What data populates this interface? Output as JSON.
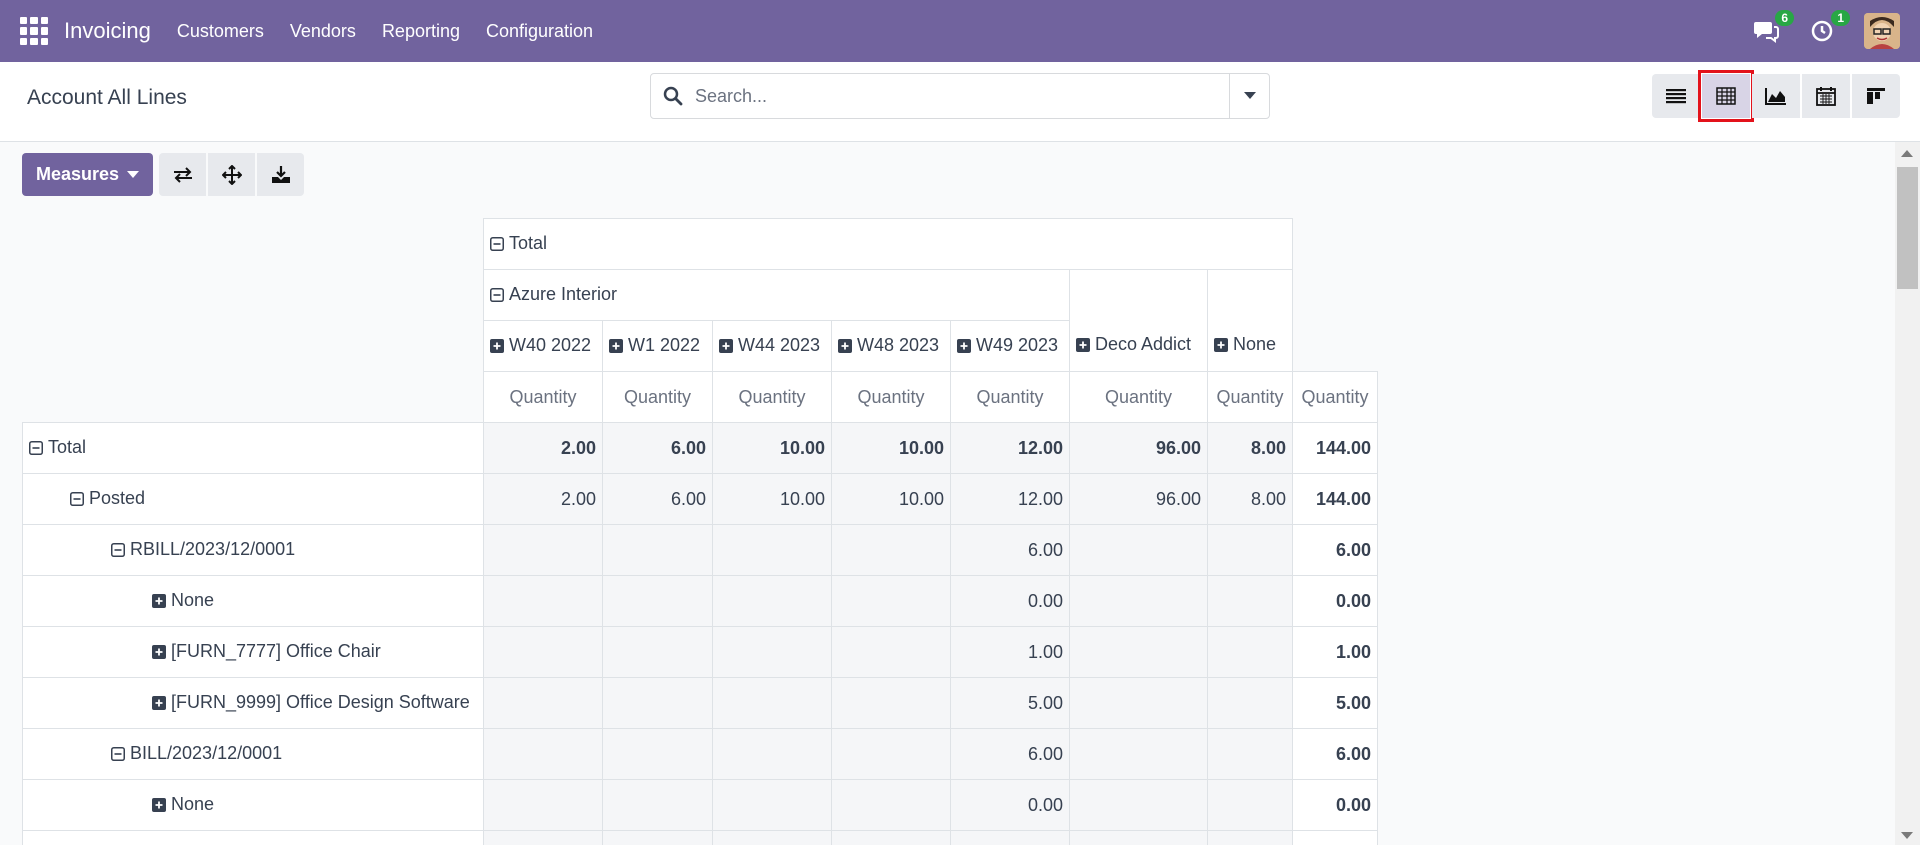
{
  "app": {
    "brand": "Invoicing",
    "menu": [
      "Customers",
      "Vendors",
      "Reporting",
      "Configuration"
    ],
    "messages_count": "6",
    "activities_count": "1"
  },
  "control_panel": {
    "title": "Account All Lines",
    "search_placeholder": "Search...",
    "views": [
      "list-view",
      "pivot-view",
      "graph-view",
      "calendar-view",
      "kanban-view"
    ],
    "active_view": "pivot-view"
  },
  "toolbar": {
    "measures_label": "Measures"
  },
  "pivot": {
    "col_headers": {
      "total": "Total",
      "azure": "Azure Interior",
      "weeks": [
        "W40 2022",
        "W1 2022",
        "W44 2023",
        "W48 2023",
        "W49 2023"
      ],
      "deco": "Deco Addict",
      "none": "None",
      "measure": "Quantity"
    },
    "rows": [
      {
        "label": "Total",
        "level": 0,
        "icon": "minus",
        "bold": true,
        "values": [
          "2.00",
          "6.00",
          "10.00",
          "10.00",
          "12.00",
          "96.00",
          "8.00"
        ],
        "total": "144.00"
      },
      {
        "label": "Posted",
        "level": 1,
        "icon": "minus",
        "values": [
          "2.00",
          "6.00",
          "10.00",
          "10.00",
          "12.00",
          "96.00",
          "8.00"
        ],
        "total": "144.00"
      },
      {
        "label": "RBILL/2023/12/0001",
        "level": 2,
        "icon": "minus",
        "values": [
          "",
          "",
          "",
          "",
          "6.00",
          "",
          ""
        ],
        "total": "6.00"
      },
      {
        "label": "None",
        "level": 3,
        "icon": "plus",
        "values": [
          "",
          "",
          "",
          "",
          "0.00",
          "",
          ""
        ],
        "total": "0.00"
      },
      {
        "label": "[FURN_7777] Office Chair",
        "level": 3,
        "icon": "plus",
        "values": [
          "",
          "",
          "",
          "",
          "1.00",
          "",
          ""
        ],
        "total": "1.00"
      },
      {
        "label": "[FURN_9999] Office Design Software",
        "level": 3,
        "icon": "plus",
        "values": [
          "",
          "",
          "",
          "",
          "5.00",
          "",
          ""
        ],
        "total": "5.00"
      },
      {
        "label": "BILL/2023/12/0001",
        "level": 2,
        "icon": "minus",
        "values": [
          "",
          "",
          "",
          "",
          "6.00",
          "",
          ""
        ],
        "total": "6.00"
      },
      {
        "label": "None",
        "level": 3,
        "icon": "plus",
        "values": [
          "",
          "",
          "",
          "",
          "0.00",
          "",
          ""
        ],
        "total": "0.00"
      },
      {
        "label": "",
        "level": 3,
        "icon": "",
        "values": [
          "",
          "",
          "",
          "",
          "",
          "",
          ""
        ],
        "total": ""
      }
    ]
  },
  "colors": {
    "navbar": "#71639e",
    "badge": "#28a745",
    "highlight": "#e3121b"
  }
}
